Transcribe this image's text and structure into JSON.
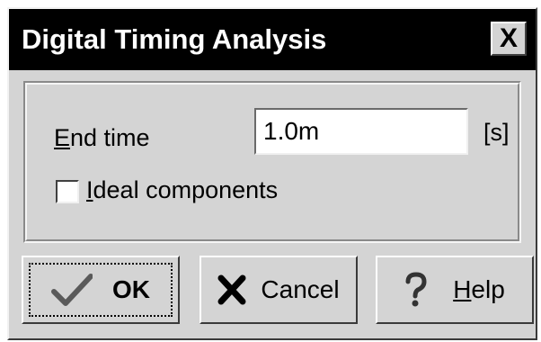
{
  "window": {
    "title": "Digital Timing Analysis",
    "close_label": "X"
  },
  "form": {
    "end_time_label_accel": "E",
    "end_time_label_rest": "nd time",
    "end_time_value": "1.0m",
    "end_time_unit": "[s]",
    "ideal_components_checked": false,
    "ideal_label_accel": "I",
    "ideal_label_rest": "deal components"
  },
  "buttons": {
    "ok_label": "OK",
    "cancel_label": "Cancel",
    "help_label_accel": "H",
    "help_label_rest": "elp"
  },
  "icons": {
    "ok": "checkmark-icon",
    "cancel": "x-mark-icon",
    "help": "question-mark-icon"
  }
}
